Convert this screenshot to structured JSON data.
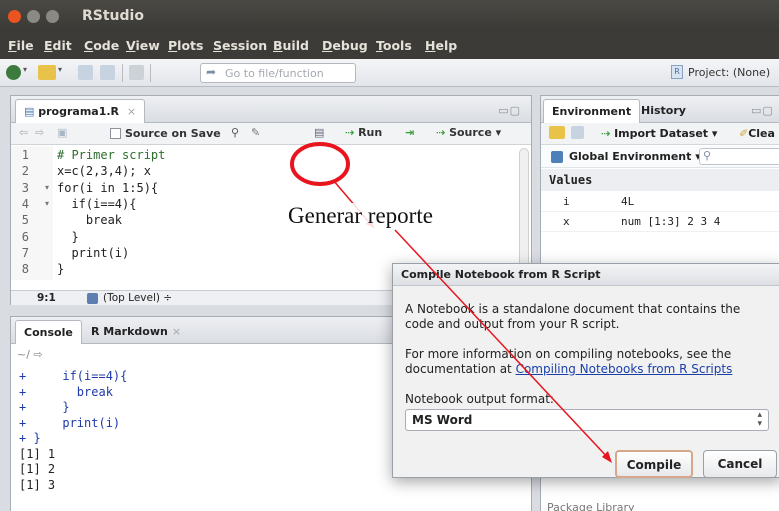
{
  "window": {
    "title": "RStudio"
  },
  "menu": [
    "File",
    "Edit",
    "Code",
    "View",
    "Plots",
    "Session",
    "Build",
    "Debug",
    "Tools",
    "Help"
  ],
  "toolbar": {
    "goto_placeholder": "Go to file/function",
    "project": "Project: (None)"
  },
  "editor": {
    "tab_label": "programa1.R",
    "source_on_save": "Source on Save",
    "run_label": "Run",
    "source_label": "Source",
    "lines": [
      {
        "no": "1",
        "text": "# Primer script"
      },
      {
        "no": "2",
        "text": "x=c(2,3,4); x"
      },
      {
        "no": "3",
        "text": "for(i in 1:5){"
      },
      {
        "no": "4",
        "text": "  if(i==4){"
      },
      {
        "no": "5",
        "text": "    break"
      },
      {
        "no": "6",
        "text": "  }"
      },
      {
        "no": "7",
        "text": "  print(i)"
      },
      {
        "no": "8",
        "text": "}"
      }
    ],
    "cursor_pos": "9:1",
    "scope": "(Top Level) ÷"
  },
  "console": {
    "tabs": [
      "Console",
      "R Markdown"
    ],
    "path": "~/",
    "lines": [
      "+     if(i==4){",
      "+       break",
      "+     }",
      "+     print(i)",
      "+ }",
      "[1] 1",
      "[1] 2",
      "[1] 3"
    ]
  },
  "environment": {
    "tabs": [
      "Environment",
      "History"
    ],
    "import_dataset": "Import Dataset",
    "clear_label": "Clea",
    "scope": "Global Environment",
    "section": "Values",
    "rows": [
      {
        "name": "i",
        "value": "4L"
      },
      {
        "name": "x",
        "value": "num [1:3] 2 3 4"
      }
    ]
  },
  "dialog": {
    "title": "Compile Notebook from R Script",
    "para1": "A Notebook is a standalone document that contains the code and output from your R script.",
    "para2_prefix": "For more information on compiling notebooks, see the documentation at ",
    "para2_link": "Compiling Notebooks from R Scripts",
    "format_label": "Notebook output format:",
    "format_value": "MS Word",
    "compile_label": "Compile",
    "cancel_label": "Cancel"
  },
  "annotation": {
    "text": "Generar reporte",
    "color": "#e8141e"
  },
  "files_pane": {
    "partial_label": "Package Library"
  }
}
